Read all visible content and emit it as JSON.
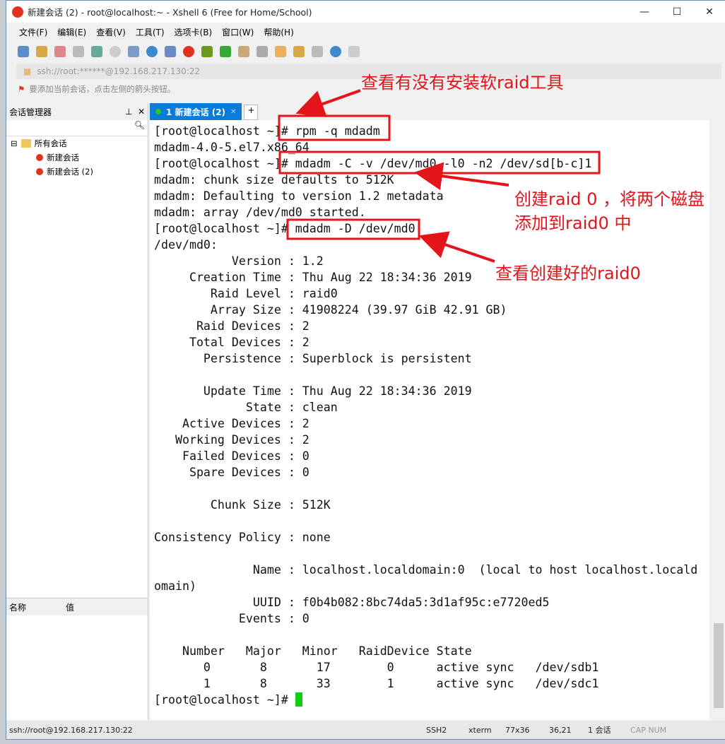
{
  "window": {
    "title": "新建会话 (2) - root@localhost:~ - Xshell 6 (Free for Home/School)"
  },
  "menu": [
    "文件(F)",
    "编辑(E)",
    "查看(V)",
    "工具(T)",
    "选项卡(B)",
    "窗口(W)",
    "帮助(H)"
  ],
  "address": "ssh://root:******@192.168.217.130:22",
  "hint": "要添加当前会话，点击左侧的箭头按钮。",
  "session_manager": {
    "title": "会话管理器",
    "root": "所有会话",
    "items": [
      "新建会话",
      "新建会话 (2)"
    ],
    "props_headers": [
      "名称",
      "值"
    ]
  },
  "tab": {
    "label": "1 新建会话 (2)",
    "add": "+"
  },
  "terminal": {
    "lines": [
      "[root@localhost ~]# rpm -q mdadm",
      "mdadm-4.0-5.el7.x86_64",
      "[root@localhost ~]# mdadm -C -v /dev/md0 -l0 -n2 /dev/sd[b-c]1",
      "mdadm: chunk size defaults to 512K",
      "mdadm: Defaulting to version 1.2 metadata",
      "mdadm: array /dev/md0 started.",
      "[root@localhost ~]# mdadm -D /dev/md0",
      "/dev/md0:",
      "           Version : 1.2",
      "     Creation Time : Thu Aug 22 18:34:36 2019",
      "        Raid Level : raid0",
      "        Array Size : 41908224 (39.97 GiB 42.91 GB)",
      "      Raid Devices : 2",
      "     Total Devices : 2",
      "       Persistence : Superblock is persistent",
      "",
      "       Update Time : Thu Aug 22 18:34:36 2019",
      "             State : clean",
      "    Active Devices : 2",
      "   Working Devices : 2",
      "    Failed Devices : 0",
      "     Spare Devices : 0",
      "",
      "        Chunk Size : 512K",
      "",
      "Consistency Policy : none",
      "",
      "              Name : localhost.localdomain:0  (local to host localhost.locald",
      "omain)",
      "              UUID : f0b4b082:8bc74da5:3d1af95c:e7720ed5",
      "            Events : 0",
      "",
      "    Number   Major   Minor   RaidDevice State",
      "       0       8       17        0      active sync   /dev/sdb1",
      "       1       8       33        1      active sync   /dev/sdc1"
    ],
    "prompt": "[root@localhost ~]# "
  },
  "annotations": [
    "查看有没有安装软raid工具",
    "创建raid 0 ，将两个磁盘",
    "添加到raid0 中",
    "查看创建好的raid0"
  ],
  "status": {
    "conn": "ssh://root@192.168.217.130:22",
    "proto": "SSH2",
    "term": "xterm",
    "size": "77x36",
    "pos": "36,21",
    "sessions": "1 会话",
    "caps": "CAP NUM"
  },
  "colors": {
    "annotation": "#e4141b",
    "tab": "#0a7bd6",
    "cursor": "#11d011"
  }
}
